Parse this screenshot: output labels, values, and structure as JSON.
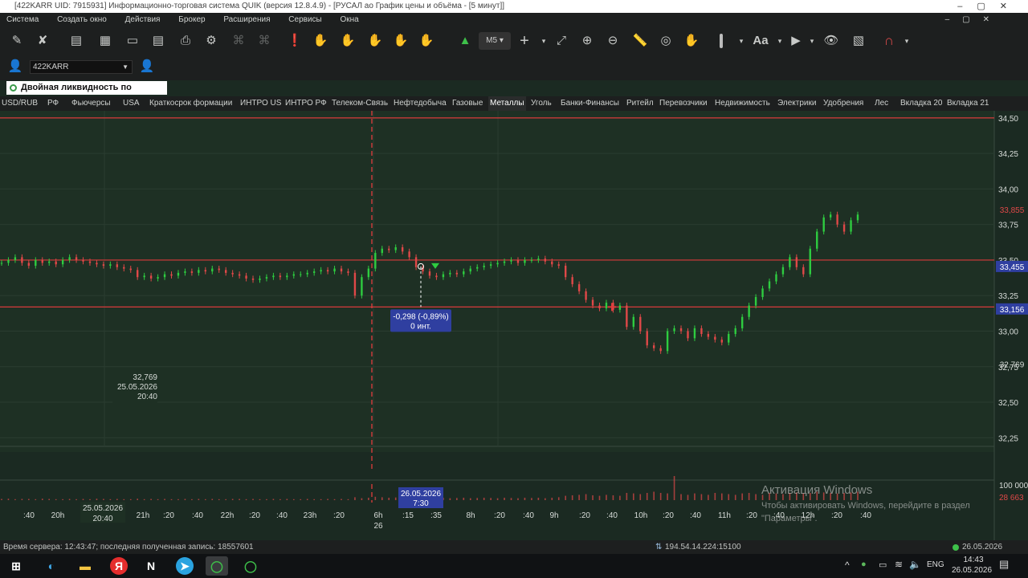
{
  "window": {
    "title": "[422KARR UID: 7915931] Информационно-торговая система QUIK (версия 12.8.4.9) - [РУСАЛ ао График цены и объёма - [5 минут]]"
  },
  "menu": [
    "Система",
    "Создать окно",
    "Действия",
    "Брокер",
    "Расширения",
    "Сервисы",
    "Окна"
  ],
  "toolbar": {
    "interval_label": "M5",
    "font_label": "Aa",
    "icons": [
      "draw-icon",
      "delete-draw-icon",
      "new-table-icon",
      "chart-icon",
      "window-icon",
      "table-icon",
      "print-icon",
      "settings-icon",
      "order-icon",
      "alert-icon",
      "buy-icon",
      "sell-icon",
      "stop-icon",
      "stop-cancel-icon",
      "add-chart-icon",
      "crosshair-icon",
      "fit-icon",
      "zoom-in-icon",
      "zoom-out-icon",
      "ruler-icon",
      "target-icon",
      "hand-icon",
      "font-icon",
      "arrow-icon",
      "hide-icon",
      "grid-icon",
      "magnet-icon"
    ]
  },
  "account": {
    "code": "422KARR"
  },
  "infopanel": {
    "label": "Двойная ликвидность по  БПИФ..."
  },
  "tabs": [
    "USD/RUB",
    "РФ",
    "Фьючерсы",
    "USA",
    "Краткосрок формации",
    "ИНТРО US",
    "ИНТРО РФ",
    "Телеком-Связь",
    "Нефтедобыча",
    "Газовые",
    "Металлы",
    "Уголь",
    "Банки-Финансы",
    "Ритейл",
    "Перевозчики",
    "Недвижимость",
    "Электрики",
    "Удобрения",
    "Лес",
    "Вкладка 20",
    "Вкладка 21"
  ],
  "active_tab": "Металлы",
  "chart_data": {
    "type": "candlestick",
    "interval": "5 минут",
    "y_ticks": [
      "34,50",
      "34,25",
      "34,00",
      "33,75",
      "33,50",
      "33,25",
      "33,00",
      "32,75",
      "32,50",
      "32,25"
    ],
    "y_range": [
      32.15,
      34.55
    ],
    "price_tags": [
      {
        "label": "33,855",
        "value": 33.855,
        "color": "#e04848",
        "style": "text"
      },
      {
        "label": "33,455",
        "value": 33.455,
        "color": "#2f3fa0",
        "style": "box"
      },
      {
        "label": "33,156",
        "value": 33.156,
        "color": "#2f3fa0",
        "style": "box"
      },
      {
        "label": "32,769",
        "value": 32.769,
        "color": "#d8dcd9",
        "style": "text"
      }
    ],
    "hlines": [
      34.5,
      33.5,
      33.17
    ],
    "cursor_tooltip": {
      "line1": "32,769",
      "line2": "25.05.2026",
      "line3": "20:40"
    },
    "measure_tooltip": {
      "line1": "-0,298 (-0,89%)",
      "line2": "0 инт."
    },
    "volume_ticks": [
      "100 000",
      "28 663"
    ],
    "x_ticks": [
      ":40",
      "20h",
      ":20",
      ":40",
      "21h",
      ":20",
      ":40",
      "22h",
      ":20",
      ":40",
      "23h",
      ":20",
      "6h",
      ":15",
      ":35",
      "8h",
      ":20",
      ":40",
      "9h",
      ":20",
      ":40",
      "10h",
      ":20",
      ":40",
      "11h",
      ":20",
      ":40",
      "12h",
      ":20",
      ":40"
    ],
    "x_day_label": "26",
    "x_cursor_label": {
      "line1": "25.05.2026",
      "line2": "20:40"
    },
    "x_measure_label": {
      "line1": "26.05.2026",
      "line2": "7:30"
    },
    "series": [
      {
        "name": "price",
        "close": [
          33.48,
          33.5,
          33.52,
          33.48,
          33.46,
          33.5,
          33.48,
          33.49,
          33.47,
          33.5,
          33.52,
          33.5,
          33.49,
          33.48,
          33.47,
          33.46,
          33.47,
          33.45,
          33.44,
          33.43,
          33.38,
          33.39,
          33.37,
          33.38,
          33.4,
          33.39,
          33.41,
          33.42,
          33.41,
          33.43,
          33.42,
          33.44,
          33.43,
          33.41,
          33.4,
          33.39,
          33.37,
          33.36,
          33.37,
          33.38,
          33.39,
          33.38,
          33.39,
          33.4,
          33.4,
          33.41,
          33.42,
          33.43,
          33.42,
          33.44,
          33.42,
          33.41,
          33.25,
          33.38,
          33.44,
          33.55,
          33.58,
          33.57,
          33.59,
          33.56,
          33.52,
          33.45,
          33.42,
          33.39,
          33.38,
          33.4,
          33.41,
          33.4,
          33.42,
          33.44,
          33.45,
          33.46,
          33.47,
          33.48,
          33.49,
          33.5,
          33.48,
          33.5,
          33.5,
          33.51,
          33.49,
          33.47,
          33.46,
          33.38,
          33.33,
          33.28,
          33.22,
          33.18,
          33.16,
          33.2,
          33.15,
          33.18,
          33.03,
          33.1,
          33.0,
          32.9,
          32.88,
          32.86,
          33.0,
          33.02,
          33.0,
          32.95,
          33.02,
          32.98,
          32.96,
          32.94,
          32.92,
          32.98,
          33.02,
          33.1,
          33.18,
          33.24,
          33.3,
          33.35,
          33.4,
          33.45,
          33.52,
          33.45,
          33.4,
          33.58,
          33.7,
          33.8,
          33.82,
          33.75,
          33.7,
          33.78,
          33.82
        ]
      }
    ],
    "volume": [
      0.05,
      0.06,
      0.04,
      0.05,
      0.05,
      0.04,
      0.06,
      0.05,
      0.04,
      0.04,
      0.05,
      0.04,
      0.05,
      0.04,
      0.06,
      0.05,
      0.04,
      0.05,
      0.04,
      0.04,
      0.06,
      0.04,
      0.05,
      0.04,
      0.05,
      0.04,
      0.04,
      0.05,
      0.04,
      0.05,
      0.04,
      0.05,
      0.04,
      0.04,
      0.05,
      0.05,
      0.04,
      0.05,
      0.04,
      0.04,
      0.05,
      0.04,
      0.05,
      0.04,
      0.04,
      0.05,
      0.04,
      0.04,
      0.05,
      0.04,
      0.05,
      0.04,
      0.12,
      0.08,
      0.1,
      0.14,
      0.12,
      0.1,
      0.11,
      0.09,
      0.1,
      0.12,
      0.1,
      0.08,
      0.09,
      0.1,
      0.08,
      0.09,
      0.1,
      0.08,
      0.09,
      0.1,
      0.09,
      0.08,
      0.1,
      0.09,
      0.08,
      0.1,
      0.09,
      0.1,
      0.08,
      0.1,
      0.12,
      0.18,
      0.2,
      0.22,
      0.25,
      0.2,
      0.18,
      0.22,
      0.2,
      0.18,
      0.3,
      0.28,
      0.25,
      0.3,
      0.35,
      0.3,
      0.28,
      1.0,
      0.25,
      0.22,
      0.28,
      0.25,
      0.22,
      0.3,
      0.28,
      0.25,
      0.22,
      0.28,
      0.3,
      0.25,
      0.22,
      0.3,
      0.28,
      0.25,
      0.3,
      0.32,
      0.28,
      0.3,
      0.35,
      0.32,
      0.3,
      0.28,
      0.3,
      0.32,
      0.35
    ]
  },
  "windows_activation": {
    "title": "Активация Windows",
    "line2": "Чтобы активировать Windows, перейдите в раздел",
    "line3": "\"Параметры\"."
  },
  "statusbar": {
    "server_info": "Время сервера: 12:43:47; последняя полученная запись: 18557601",
    "connection": "194.54.14.224:15100",
    "date": "26.05.2026"
  },
  "taskbar": {
    "language": "ENG",
    "time": "14:43",
    "date": "26.05.2026",
    "apps": [
      "start-icon",
      "edge-icon",
      "explorer-icon",
      "yandex-icon",
      "app-n-icon",
      "telegram-icon",
      "quik-icon",
      "quik2-icon"
    ]
  },
  "colors": {
    "chart_bg": "#1b2a22",
    "up": "#2ecc40",
    "down": "#e04848",
    "hline": "#e03c3c",
    "tag_blue": "#2f3fa0"
  }
}
